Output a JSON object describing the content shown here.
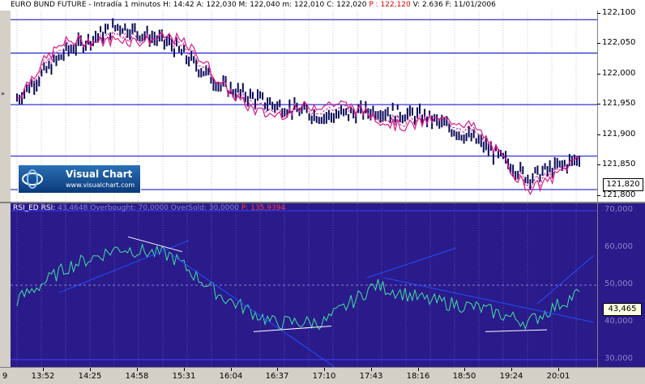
{
  "info_bar": {
    "title": "EURO BUND FUTURE - Intradía 1 minutos",
    "high": "H: 14:42",
    "ask": "A: 122,030",
    "mid": "M: 122,040",
    "min": "m: 122,010",
    "close": "C: 122,020",
    "p": "P : 122,120",
    "volume": "V: 2.636",
    "date": "F: 11/01/2006"
  },
  "price_axis": {
    "ticks": [
      "122,100",
      "122,050",
      "122,000",
      "121,950",
      "121,900",
      "121,850",
      "121,800"
    ],
    "last_price": "121,820"
  },
  "logo": {
    "brand": "Visual Chart",
    "url": "www.visualchart.com"
  },
  "indicator": {
    "label": "RSI_ED RSI:",
    "value_1": "43,4648",
    "overbought": "Overbought: 70,0000",
    "oversold": "OverSold: 30,0000",
    "p": "P: 135,9394",
    "ticks": [
      "70,000",
      "60,000",
      "50,000",
      "40,000",
      "30,000"
    ],
    "last_value": "43,465"
  },
  "time_axis": {
    "first": "9",
    "labels": [
      "13:52",
      "14:25",
      "14:58",
      "15:31",
      "16:04",
      "16:37",
      "17:10",
      "17:43",
      "18:16",
      "18:50",
      "19:24",
      "20:01"
    ]
  },
  "colors": {
    "price_bars": "#0a0a5a",
    "price_ma": "#d0208a",
    "level_lines": "#0000cc",
    "indicator_bg": "#2a1a8a",
    "rsi_line": "#40e0a0",
    "trend_lines": "#2050ff",
    "divergence_lines": "#ffffff"
  },
  "chart_data": [
    {
      "type": "line",
      "title": "EURO BUND FUTURE - Intradía 1 minutos",
      "series": [
        {
          "x": [
            "13:52",
            "14:25",
            "14:58",
            "15:31",
            "16:04",
            "16:37",
            "17:10",
            "17:43",
            "18:16",
            "18:50",
            "19:24",
            "20:01"
          ],
          "values": [
            121.96,
            122.04,
            122.08,
            122.05,
            121.98,
            121.95,
            121.93,
            121.94,
            121.93,
            121.89,
            121.83,
            121.86
          ]
        }
      ],
      "reference_lines": [
        122.09,
        122.035,
        121.95,
        121.865,
        121.81
      ],
      "ylim": [
        121.79,
        122.105
      ],
      "grid": true
    },
    {
      "type": "line",
      "title": "RSI_ED RSI:",
      "series": [
        {
          "x": [
            "13:52",
            "14:25",
            "14:58",
            "15:31",
            "16:04",
            "16:37",
            "17:10",
            "17:43",
            "18:16",
            "18:50",
            "19:24",
            "20:01"
          ],
          "values": [
            46,
            55,
            60,
            58,
            47,
            40,
            40,
            50,
            46,
            44,
            40,
            48
          ]
        }
      ],
      "reference_lines": [
        70,
        30
      ],
      "ylim": [
        28,
        72
      ],
      "grid": true
    }
  ]
}
